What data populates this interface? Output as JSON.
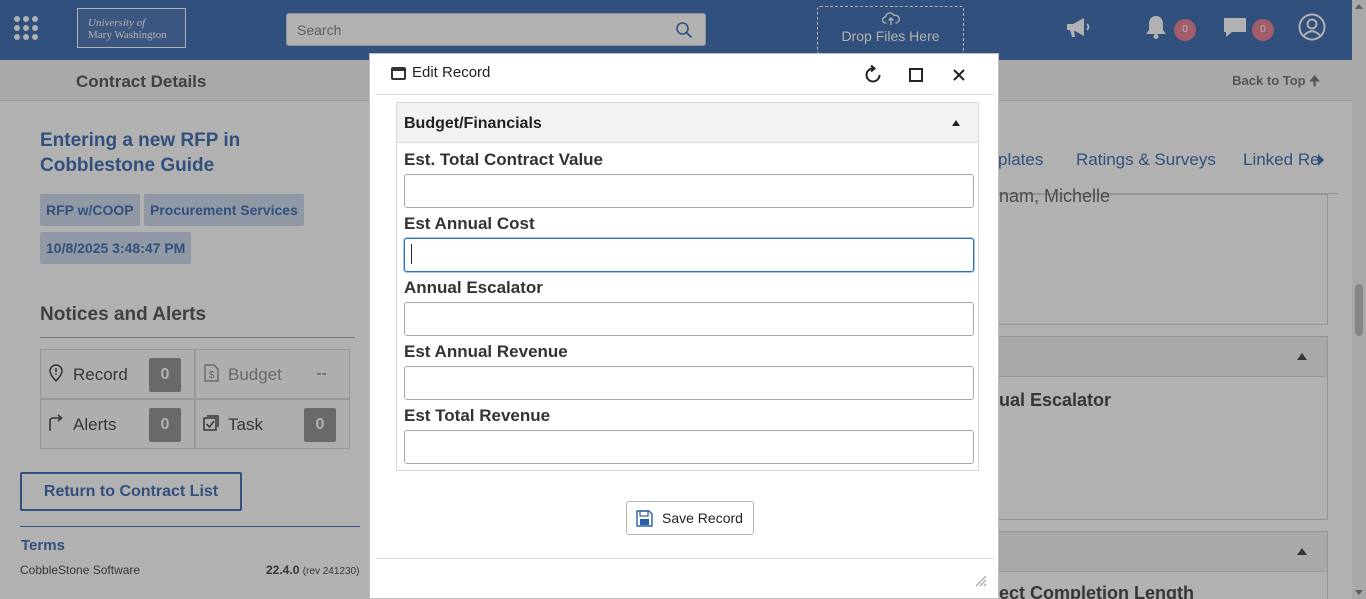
{
  "header": {
    "logo_line1": "University of",
    "logo_line2": "Mary Washington",
    "search_placeholder": "Search",
    "drop_files": "Drop Files Here",
    "alerts_count": "0",
    "messages_count": "0"
  },
  "subheader": {
    "title": "Contract Details",
    "back_to_top": "Back to Top"
  },
  "left_panel": {
    "record_title": "Entering a new RFP in Cobblestone Guide",
    "tags": [
      "RFP w/COOP",
      "Procurement Services",
      "10/8/2025 3:48:47 PM"
    ],
    "notices_title": "Notices and Alerts",
    "counters": {
      "record_label": "Record",
      "record_value": "0",
      "budget_label": "Budget",
      "budget_value": "--",
      "alerts_label": "Alerts",
      "alerts_value": "0",
      "task_label": "Task",
      "task_value": "0"
    },
    "return_button": "Return to Contract List",
    "terms": "Terms",
    "software": "CobbleStone Software",
    "version": "22.4.0",
    "revision": "(rev 241230)"
  },
  "right_panel": {
    "tabs": [
      "plates",
      "Ratings & Surveys",
      "Linked Re"
    ],
    "partial_text_1": "nam, Michelle",
    "partial_text_2": "ual Escalator",
    "partial_text_3": "ect Completion Length"
  },
  "modal": {
    "title": "Edit Record",
    "section_title": "Budget/Financials",
    "fields": [
      {
        "label": "Est. Total Contract Value",
        "value": ""
      },
      {
        "label": "Est Annual Cost",
        "value": ""
      },
      {
        "label": "Annual Escalator",
        "value": ""
      },
      {
        "label": "Est Annual Revenue",
        "value": ""
      },
      {
        "label": "Est Total Revenue",
        "value": ""
      }
    ],
    "save_button": "Save Record"
  },
  "colors": {
    "brand_blue": "#2a5ea8",
    "badge_pink": "#e8768c",
    "counter_gray": "#888888"
  },
  "icons": [
    "apps-grid-icon",
    "search-icon",
    "upload-cloud-icon",
    "megaphone-icon",
    "bell-icon",
    "chat-icon",
    "user-profile-icon",
    "alert-pin-icon",
    "budget-dollar-icon",
    "route-arrow-icon",
    "task-check-icon",
    "window-icon",
    "refresh-icon",
    "maximize-icon",
    "close-icon",
    "save-disk-icon",
    "resize-handle-icon"
  ]
}
